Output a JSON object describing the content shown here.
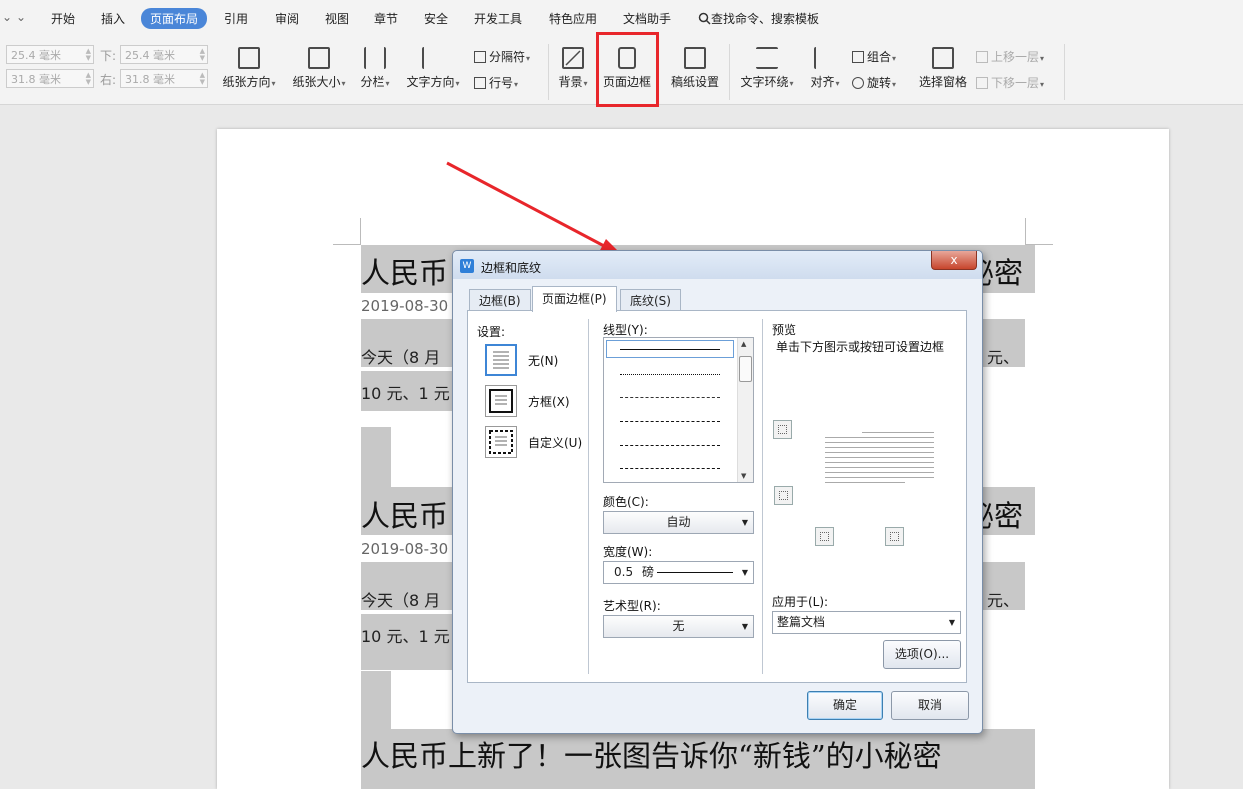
{
  "menu": {
    "chevron": "⌄",
    "items": [
      "开始",
      "插入",
      "页面布局",
      "引用",
      "审阅",
      "视图",
      "章节",
      "安全",
      "开发工具",
      "特色应用",
      "文档助手"
    ],
    "active": "页面布局",
    "search": "查找命令、搜索模板"
  },
  "ribbon": {
    "margins": {
      "top_value": "25.4 毫米",
      "bottom_label": "下:",
      "bottom_value": "25.4 毫米",
      "left_value": "31.8 毫米",
      "right_label": "右:",
      "right_value": "31.8 毫米"
    },
    "orientation": "纸张方向",
    "size": "纸张大小",
    "columns": "分栏",
    "text_direction": "文字方向",
    "breaks": "分隔符",
    "line_numbers": "行号",
    "background": "背景",
    "page_border": "页面边框",
    "manuscript": "稿纸设置",
    "text_wrap": "文字环绕",
    "align": "对齐",
    "group": "组合",
    "rotate": "旋转",
    "selection_pane": "选择窗格",
    "bring_forward": "上移一层",
    "send_backward": "下移一层"
  },
  "document": {
    "title": "人民币上新了！一张图告诉你“新钱”的小秘密",
    "title_left": "人民币",
    "title_right": "秘密",
    "date": "2019-08-30",
    "body_start": "今天（8 月",
    "body_end": "元、",
    "line2_start": "10 元、1 元"
  },
  "dialog": {
    "title": "边框和底纹",
    "close": "x",
    "tabs": [
      "边框(B)",
      "页面边框(P)",
      "底纹(S)"
    ],
    "active_tab": 1,
    "setting_label": "设置:",
    "settings": [
      "无(N)",
      "方框(X)",
      "自定义(U)"
    ],
    "style_label": "线型(Y):",
    "color_label": "颜色(C):",
    "color_value": "自动",
    "width_label": "宽度(W):",
    "width_value": "0.5",
    "width_unit": "磅",
    "art_label": "艺术型(R):",
    "art_value": "无",
    "preview_label": "预览",
    "preview_hint": "单击下方图示或按钮可设置边框",
    "apply_label": "应用于(L):",
    "apply_value": "整篇文档",
    "options_button": "选项(O)...",
    "ok_button": "确定",
    "cancel_button": "取消"
  },
  "colors": {
    "accent": "#4a86d8",
    "highlight": "#e8262b"
  }
}
